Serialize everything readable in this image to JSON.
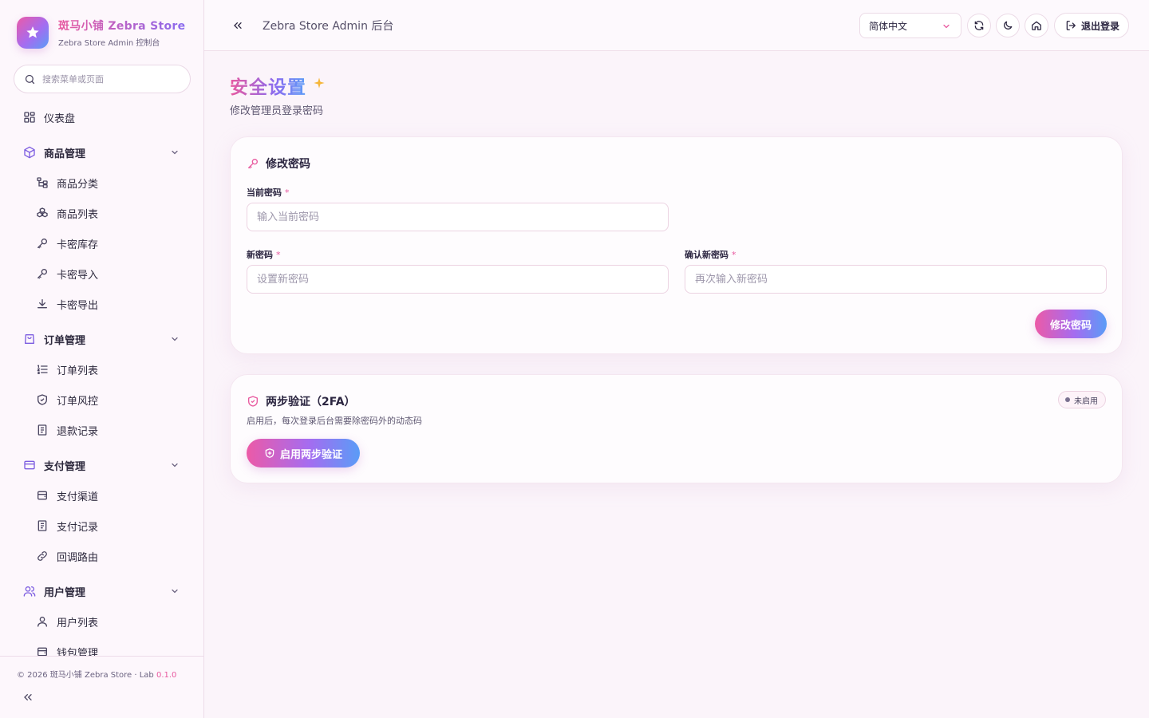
{
  "brand": {
    "title": "斑马小铺 Zebra Store",
    "subtitle": "Zebra Store Admin 控制台",
    "logo_icon": "star-icon"
  },
  "sidebar": {
    "search_placeholder": "搜索菜单或页面",
    "items": [
      {
        "label": "仪表盘",
        "icon": "dashboard-icon",
        "type": "top"
      },
      {
        "label": "商品管理",
        "icon": "box-icon",
        "type": "group"
      },
      {
        "label": "商品分类",
        "icon": "tree-icon",
        "type": "sub"
      },
      {
        "label": "商品列表",
        "icon": "boxes-icon",
        "type": "sub"
      },
      {
        "label": "卡密库存",
        "icon": "key-icon",
        "type": "sub"
      },
      {
        "label": "卡密导入",
        "icon": "key-icon",
        "type": "sub"
      },
      {
        "label": "卡密导出",
        "icon": "download-icon",
        "type": "sub"
      },
      {
        "label": "订单管理",
        "icon": "bag-icon",
        "type": "group"
      },
      {
        "label": "订单列表",
        "icon": "list-ordered-icon",
        "type": "sub"
      },
      {
        "label": "订单风控",
        "icon": "shield-icon",
        "type": "sub"
      },
      {
        "label": "退款记录",
        "icon": "receipt-icon",
        "type": "sub"
      },
      {
        "label": "支付管理",
        "icon": "card-icon",
        "type": "group"
      },
      {
        "label": "支付渠道",
        "icon": "wallet-icon",
        "type": "sub"
      },
      {
        "label": "支付记录",
        "icon": "receipt-icon",
        "type": "sub"
      },
      {
        "label": "回调路由",
        "icon": "link-icon",
        "type": "sub"
      },
      {
        "label": "用户管理",
        "icon": "users-icon",
        "type": "group"
      },
      {
        "label": "用户列表",
        "icon": "user-icon",
        "type": "sub"
      },
      {
        "label": "钱包管理",
        "icon": "wallet-icon",
        "type": "sub"
      }
    ],
    "footer": {
      "copyright": "© 2026 斑马小铺 Zebra Store · Lab",
      "version": "0.1.0"
    }
  },
  "header": {
    "title": "Zebra Store Admin 后台",
    "language": "简体中文",
    "logout_label": "退出登录"
  },
  "page": {
    "title": "安全设置",
    "subtitle": "修改管理员登录密码"
  },
  "password_card": {
    "title": "修改密码",
    "current_label": "当前密码",
    "current_placeholder": "输入当前密码",
    "new_label": "新密码",
    "new_placeholder": "设置新密码",
    "confirm_label": "确认新密码",
    "confirm_placeholder": "再次输入新密码",
    "required_mark": "*",
    "submit_label": "修改密码"
  },
  "twofa_card": {
    "title": "两步验证（2FA）",
    "description": "启用后，每次登录后台需要除密码外的动态码",
    "status": "未启用",
    "enable_label": "启用两步验证"
  },
  "colors": {
    "accent_pink": "#ec5aa7",
    "accent_purple": "#a56cf0",
    "accent_blue": "#5a9cf7",
    "icon_purple": "#7c5ce0"
  }
}
